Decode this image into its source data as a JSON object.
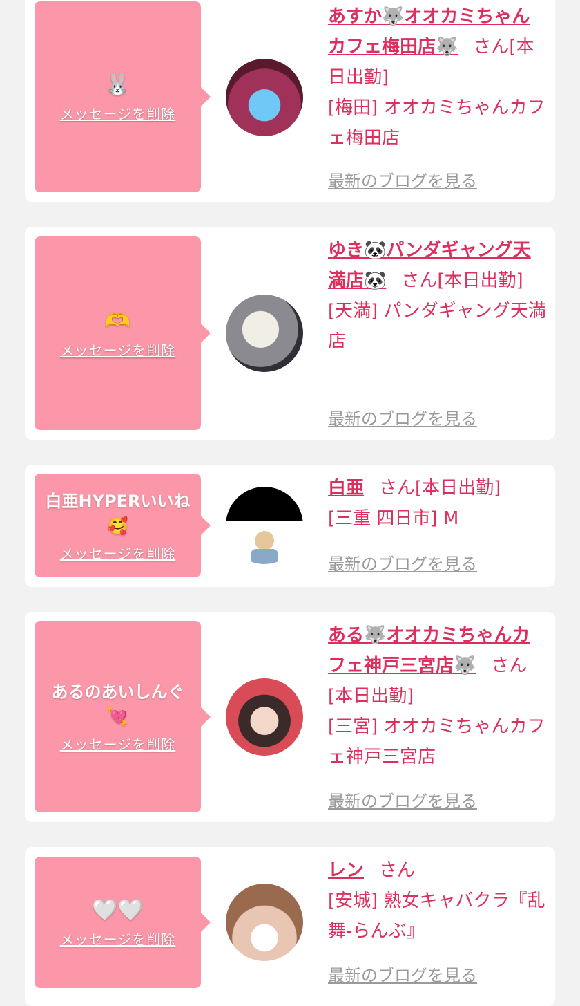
{
  "delete_label": "メッセージを削除",
  "blog_label": "最新のブログを見る",
  "colors": {
    "accent": "#dd2f5e",
    "bubble": "#fb97a8",
    "background": "#f2f2f2",
    "card": "#ffffff"
  },
  "cards": [
    {
      "message": "🐰",
      "name": "あすか🐺オオカミちゃんカフェ梅田店🐺",
      "suffix": "さん[本日出勤]",
      "shop": "[梅田] オオカミちゃんカフェ梅田店"
    },
    {
      "message": "🫶",
      "name": "ゆき🐼パンダギャング天満店🐼",
      "suffix": "さん[本日出勤]",
      "shop": "[天満] パンダギャング天満店"
    },
    {
      "message": "白亜HYPERいいね🥰",
      "name": "白亜",
      "suffix": "さん[本日出勤]",
      "shop": "[三重 四日市] M"
    },
    {
      "message": "あるのあいしんぐ💘",
      "name": "ある🐺オオカミちゃんカフェ神戸三宮店🐺",
      "suffix": "さん[本日出勤]",
      "shop": "[三宮] オオカミちゃんカフェ神戸三宮店"
    },
    {
      "message": "🤍🤍",
      "name": "レン",
      "suffix": "さん",
      "shop": "[安城] 熟女キャバクラ『乱舞-らんぶ』"
    }
  ]
}
